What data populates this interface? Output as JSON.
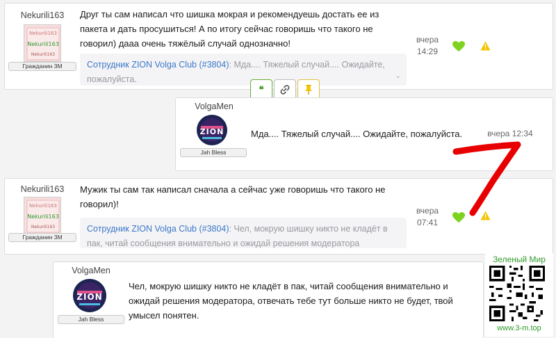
{
  "posts": [
    {
      "author": "Nekurili163",
      "rank": "Гражданин 3М",
      "avatar_text": [
        "Nekurili163",
        "Nekurili163",
        "Nekurili163"
      ],
      "text": "Друг ты сам написал что шишка мокрая и рекомендуешь достать ее из пакета и дать просушиться! А по итогу сейчас говоришь что такого не говорил) дааа очень тяжёлый случай однозначно!",
      "quote_author": "Сотрудник ZION Volga Club (#3804)",
      "quote_text": ": Мда.... Тяжелый случай.... Ожидайте, пожалуйста.",
      "time_day": "вчера",
      "time_clock": "14:29"
    },
    {
      "author": "VolgaMen",
      "rank": "Jah Bless",
      "avatar_text": "ZION",
      "text": "Мда.... Тяжелый случай.... Ожидайте, пожалуйста.",
      "time": "вчера 12:34"
    },
    {
      "author": "Nekurili163",
      "rank": "Гражданин 3М",
      "avatar_text": [
        "Nekurili163",
        "Nekurili163",
        "Nekurili163"
      ],
      "text": "Мужик ты сам так написал сначала а сейчас уже говоришь что такого не говорил)!",
      "quote_author": "Сотрудник ZION Volga Club (#3804)",
      "quote_text": ": Чел, мокрую шишку никто не кладёт в пак, читай сообщения внимательно и ожидай решения модератора",
      "time_day": "вчера",
      "time_clock": "07:41"
    },
    {
      "author": "VolgaMen",
      "rank": "Jah Bless",
      "avatar_text": "ZION",
      "text": "Чел, мокрую шишку никто не кладёт в пак, читай сообщения внимательно и ожидай решения модератора, отвечать тебе тут больше никто не будет, твой умысел понятен."
    }
  ],
  "actions": {
    "quote_glyph": "❝",
    "link_glyph": "🔗",
    "pin_glyph": "📌"
  },
  "icons": [
    "heart-icon",
    "warning-icon",
    "quote-icon",
    "link-icon",
    "pin-icon"
  ],
  "colors": {
    "link": "#3c78c8",
    "heart": "#7ed321",
    "warning": "#f5c400",
    "annotation": "#e80000",
    "watermark": "#2f9a2a"
  },
  "watermark": {
    "title": "Зеленый Мир",
    "url": "www.3-m.top"
  }
}
